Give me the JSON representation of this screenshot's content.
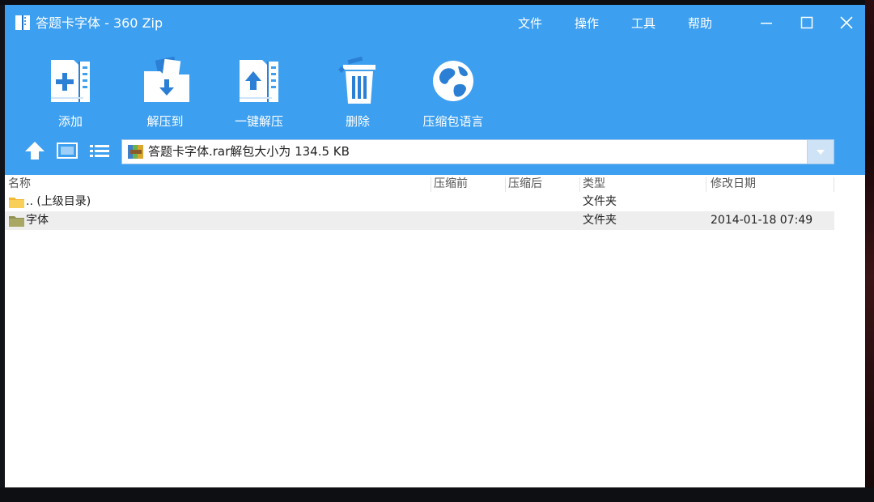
{
  "window": {
    "title": "答题卡字体 - 360 Zip"
  },
  "menu": [
    "文件",
    "操作",
    "工具",
    "帮助"
  ],
  "toolbar": [
    {
      "label": "添加",
      "icon": "add-file-icon"
    },
    {
      "label": "解压到",
      "icon": "extract-to-icon"
    },
    {
      "label": "一键解压",
      "icon": "one-click-extract-icon"
    },
    {
      "label": "删除",
      "icon": "trash-icon"
    },
    {
      "label": "压缩包语言",
      "icon": "globe-icon"
    }
  ],
  "path": {
    "text": "答题卡字体.rar解包大小为 134.5 KB"
  },
  "columns": [
    "名称",
    "压缩前",
    "压缩后",
    "类型",
    "修改日期"
  ],
  "files": [
    {
      "name": ".. (上级目录)",
      "before": "",
      "after": "",
      "type": "文件夹",
      "date": ""
    },
    {
      "name": "字体",
      "before": "",
      "after": "",
      "type": "文件夹",
      "date": "2014-01-18 07:49"
    }
  ],
  "colors": {
    "accent": "#3c9ff0",
    "folder": "#f5c542",
    "selected_row": "#eeeeee"
  }
}
